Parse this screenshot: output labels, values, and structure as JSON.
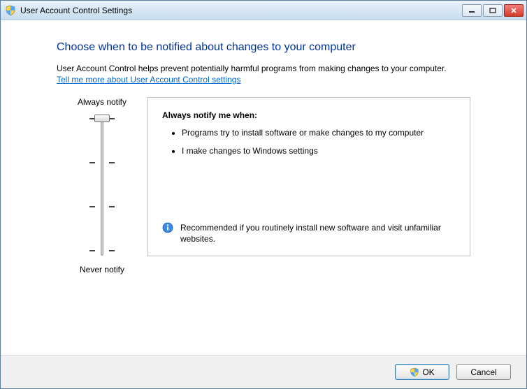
{
  "window": {
    "title": "User Account Control Settings"
  },
  "content": {
    "heading": "Choose when to be notified about changes to your computer",
    "subtext": "User Account Control helps prevent potentially harmful programs from making changes to your computer.",
    "help_link": "Tell me more about User Account Control settings"
  },
  "slider": {
    "top_label": "Always notify",
    "bottom_label": "Never notify",
    "levels": 4,
    "current_level": 0
  },
  "description": {
    "title": "Always notify me when:",
    "bullets": [
      "Programs try to install software or make changes to my computer",
      "I make changes to Windows settings"
    ],
    "recommendation": "Recommended if you routinely install new software and visit unfamiliar websites."
  },
  "footer": {
    "ok_label": "OK",
    "cancel_label": "Cancel"
  }
}
